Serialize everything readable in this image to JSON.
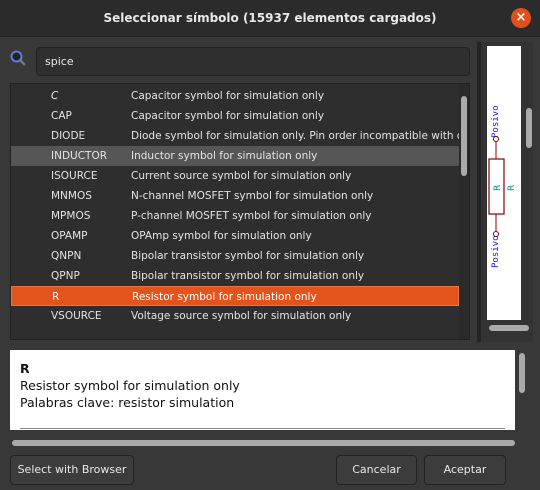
{
  "title": "Seleccionar símbolo (15937 elementos cargados)",
  "search": {
    "value": "spice"
  },
  "rows": [
    {
      "name": "C",
      "desc": "Capacitor symbol for simulation only"
    },
    {
      "name": "CAP",
      "desc": "Capacitor symbol for simulation only"
    },
    {
      "name": "DIODE",
      "desc": "Diode symbol for simulation only. Pin order incompatible with official"
    },
    {
      "name": "INDUCTOR",
      "desc": "Inductor symbol for simulation only"
    },
    {
      "name": "ISOURCE",
      "desc": "Current source symbol for simulation only"
    },
    {
      "name": "MNMOS",
      "desc": "N-channel MOSFET symbol for simulation only"
    },
    {
      "name": "MPMOS",
      "desc": "P-channel MOSFET symbol for simulation only"
    },
    {
      "name": "OPAMP",
      "desc": "OPAmp symbol for simulation only"
    },
    {
      "name": "QNPN",
      "desc": "Bipolar transistor symbol for simulation only"
    },
    {
      "name": "QPNP",
      "desc": "Bipolar transistor symbol for simulation only"
    },
    {
      "name": "R",
      "desc": "Resistor symbol for simulation only"
    },
    {
      "name": "VSOURCE",
      "desc": "Voltage source symbol for simulation only"
    }
  ],
  "preview": {
    "ref": "R",
    "value": "R",
    "pin_top": "Posivo",
    "pin_bottom": "Posivo"
  },
  "details": {
    "name": "R",
    "description": "Resistor symbol for simulation only",
    "keywords": "Palabras clave: resistor simulation"
  },
  "buttons": {
    "browser": "Select with Browser",
    "cancel": "Cancelar",
    "ok": "Aceptar"
  },
  "colors": {
    "accent": "#e2541c"
  }
}
